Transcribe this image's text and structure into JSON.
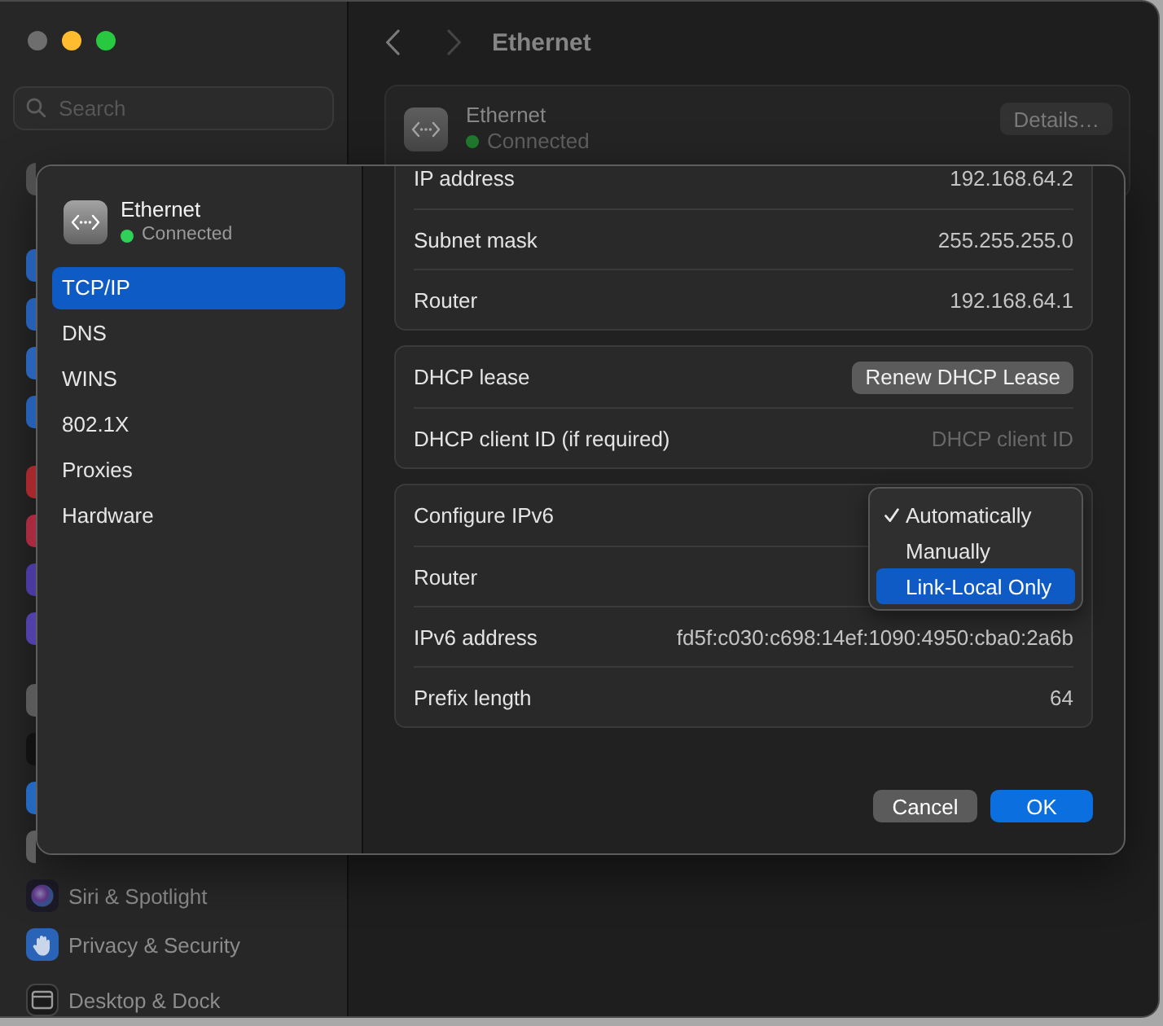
{
  "window": {
    "traffic_lights": [
      {
        "color": "#6e6e6e"
      },
      {
        "color": "#febc2e"
      },
      {
        "color": "#28c840"
      }
    ]
  },
  "sidebar": {
    "search": {
      "placeholder": "Search"
    },
    "groups": [
      {
        "items": [
          {
            "kind": "avatar",
            "color": "#4f4f4f"
          }
        ]
      },
      {
        "items": [
          {
            "kind": "tile",
            "color": "#2660b4"
          },
          {
            "kind": "tile",
            "color": "#2660b4"
          },
          {
            "kind": "tile",
            "color": "#2a64b8"
          },
          {
            "kind": "tile",
            "color": "#2660b4"
          }
        ]
      },
      {
        "items": [
          {
            "kind": "tile",
            "color": "#a5282c"
          },
          {
            "kind": "tile",
            "color": "#a82a40"
          },
          {
            "kind": "tile",
            "color": "#4a3aa0"
          },
          {
            "kind": "tile",
            "color": "#5040a8"
          }
        ]
      },
      {
        "items": [
          {
            "kind": "tile",
            "color": "#5a5a5a"
          },
          {
            "kind": "tile",
            "color": "#111111"
          },
          {
            "kind": "tile",
            "color": "#2468c0"
          },
          {
            "kind": "tile",
            "color": "#5e5e5e"
          },
          {
            "kind": "orb",
            "label": "Siri & Spotlight"
          },
          {
            "kind": "hand",
            "label": "Privacy & Security"
          }
        ]
      },
      {
        "items": [
          {
            "kind": "window",
            "label": "Desktop & Dock"
          }
        ]
      }
    ]
  },
  "toolbar": {
    "title": "Ethernet"
  },
  "card": {
    "name": "Ethernet",
    "status": "Connected",
    "connected": true,
    "button": "Details…"
  },
  "dialog": {
    "service": {
      "name": "Ethernet",
      "status": "Connected",
      "connected": true
    },
    "nav": [
      {
        "label": "TCP/IP",
        "selected": true
      },
      {
        "label": "DNS",
        "selected": false
      },
      {
        "label": "WINS",
        "selected": false
      },
      {
        "label": "802.1X",
        "selected": false
      },
      {
        "label": "Proxies",
        "selected": false
      },
      {
        "label": "Hardware",
        "selected": false
      }
    ],
    "groups": [
      {
        "rows": [
          {
            "kind": "value",
            "label": "IP address",
            "value": "192.168.64.2"
          },
          {
            "kind": "value",
            "label": "Subnet mask",
            "value": "255.255.255.0"
          },
          {
            "kind": "value",
            "label": "Router",
            "value": "192.168.64.1"
          }
        ]
      },
      {
        "rows": [
          {
            "kind": "button",
            "label": "DHCP lease",
            "button": "Renew DHCP Lease"
          },
          {
            "kind": "field",
            "label": "DHCP client ID (if required)",
            "placeholder": "DHCP client ID"
          }
        ]
      },
      {
        "rows": [
          {
            "kind": "popup",
            "label": "Configure IPv6",
            "menu": [
              {
                "label": "Automatically",
                "checked": true,
                "selected": false
              },
              {
                "label": "Manually",
                "checked": false,
                "selected": false
              },
              {
                "label": "Link-Local Only",
                "checked": false,
                "selected": true
              }
            ]
          },
          {
            "kind": "value",
            "label": "Router"
          },
          {
            "kind": "value",
            "label": "IPv6 address",
            "value": "fd5f:c030:c698:14ef:1090:4950:cba0:2a6b"
          },
          {
            "kind": "value",
            "label": "Prefix length",
            "value": "64"
          }
        ]
      }
    ],
    "buttons": [
      {
        "label": "Cancel",
        "kind": "secondary"
      },
      {
        "label": "OK",
        "kind": "primary"
      }
    ]
  }
}
